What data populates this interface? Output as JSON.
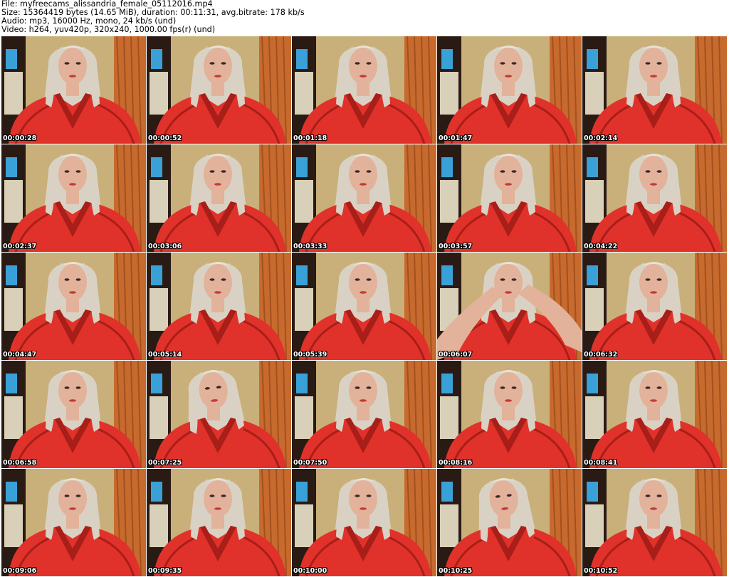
{
  "header": {
    "file_line": "File: myfreecams_alissandria_female_05112016.mp4",
    "size_line": "Size: 15364419 bytes (14.65 MiB), duration: 00:11:31, avg.bitrate: 178 kb/s",
    "audio_line": "Audio: mp3, 16000 Hz, mono, 24 kb/s (und)",
    "video_line": "Video: h264, yuv420p, 320x240, 1000.00 fps(r) (und)"
  },
  "colors": {
    "robe": "#e0322a",
    "robe_shadow": "#a81e18",
    "wall": "#c9b07a",
    "curtain": "#c76a2e",
    "hair": "#d9d2c4",
    "skin": "#e2b29a",
    "window": "#3aa0d8",
    "dark_frame": "#2a1a14"
  },
  "thumbnails": [
    {
      "timestamp": "00:00:28",
      "pose": "normal"
    },
    {
      "timestamp": "00:00:52",
      "pose": "normal"
    },
    {
      "timestamp": "00:01:18",
      "pose": "normal"
    },
    {
      "timestamp": "00:01:47",
      "pose": "normal"
    },
    {
      "timestamp": "00:02:14",
      "pose": "normal"
    },
    {
      "timestamp": "00:02:37",
      "pose": "normal"
    },
    {
      "timestamp": "00:03:06",
      "pose": "normal"
    },
    {
      "timestamp": "00:03:33",
      "pose": "normal"
    },
    {
      "timestamp": "00:03:57",
      "pose": "normal"
    },
    {
      "timestamp": "00:04:22",
      "pose": "normal"
    },
    {
      "timestamp": "00:04:47",
      "pose": "normal"
    },
    {
      "timestamp": "00:05:14",
      "pose": "normal"
    },
    {
      "timestamp": "00:05:39",
      "pose": "normal"
    },
    {
      "timestamp": "00:06:07",
      "pose": "arms-up"
    },
    {
      "timestamp": "00:06:32",
      "pose": "normal"
    },
    {
      "timestamp": "00:06:58",
      "pose": "normal"
    },
    {
      "timestamp": "00:07:25",
      "pose": "tilted"
    },
    {
      "timestamp": "00:07:50",
      "pose": "normal"
    },
    {
      "timestamp": "00:08:16",
      "pose": "normal"
    },
    {
      "timestamp": "00:08:41",
      "pose": "normal"
    },
    {
      "timestamp": "00:09:06",
      "pose": "normal"
    },
    {
      "timestamp": "00:09:35",
      "pose": "normal"
    },
    {
      "timestamp": "00:10:00",
      "pose": "normal"
    },
    {
      "timestamp": "00:10:25",
      "pose": "tilted"
    },
    {
      "timestamp": "00:10:52",
      "pose": "normal"
    }
  ]
}
